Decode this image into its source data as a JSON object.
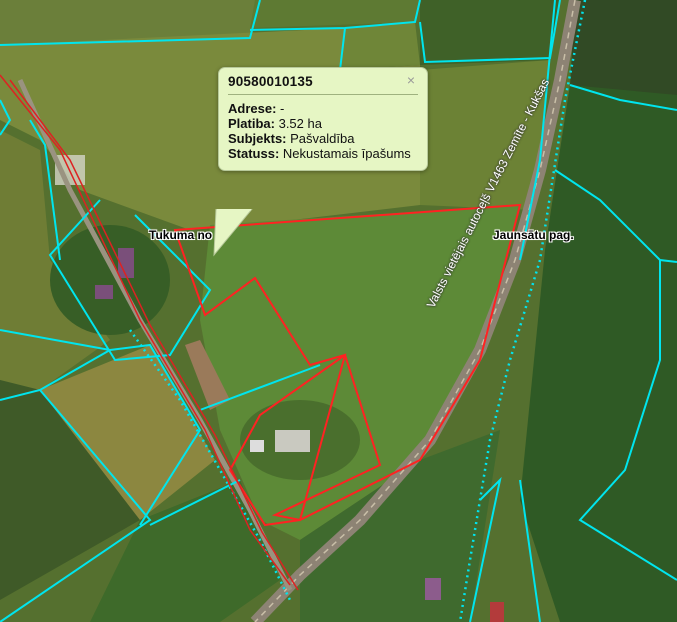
{
  "popup": {
    "cadastral_number": "90580010135",
    "close_symbol": "×",
    "fields": {
      "adrese_label": "Adrese:",
      "adrese_value": "-",
      "platiba_label": "Platiba:",
      "platiba_value": "3.52 ha",
      "subjekts_label": "Subjekts:",
      "subjekts_value": "Pašvaldība",
      "statuss_label": "Statuss:",
      "statuss_value": "Nekustamais īpašums"
    }
  },
  "labels": {
    "parish_left": "Tukuma no",
    "parish_right": "Jaunsātu pag.",
    "road": "Valsts vietējais autoceļš V1463 Zemīte - Kukšas"
  },
  "colors": {
    "parcel_boundary": "#00e5ee",
    "selected_parcel": "#ff2222",
    "popup_bg": "#e6f6c4"
  }
}
